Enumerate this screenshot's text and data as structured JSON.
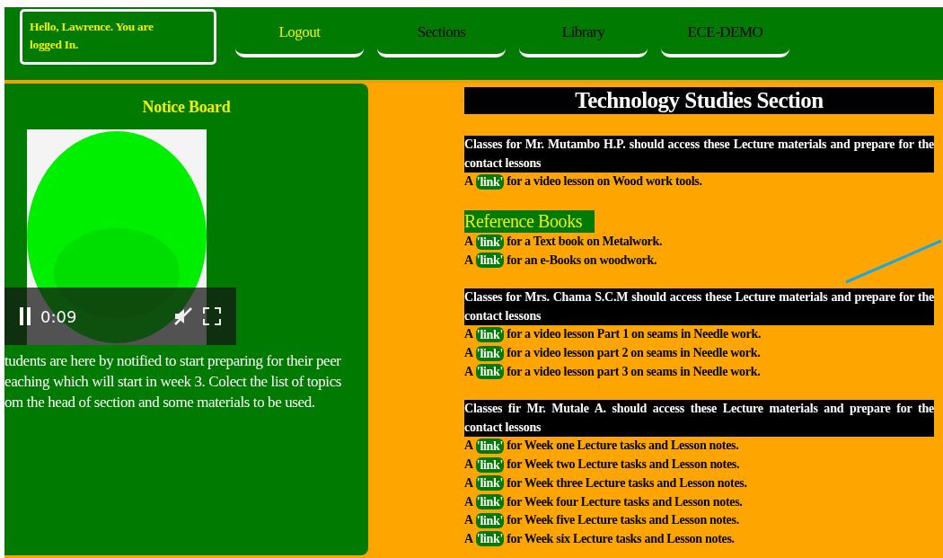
{
  "header": {
    "greeting": "Hello, Lawrence. You are logged In.",
    "nav": [
      {
        "label": "Logout",
        "selected": true
      },
      {
        "label": "Sections",
        "selected": false
      },
      {
        "label": "Library",
        "selected": false
      },
      {
        "label": "ECE-DEMO",
        "selected": false
      }
    ]
  },
  "notice_board": {
    "title": "Notice Board",
    "video": {
      "kind": "picture",
      "time": "0:09",
      "playing": true
    },
    "lines": [
      "tudents are here by notified to start preparing for their peer",
      "eaching which will start in week 3. Colect the list of topics",
      "om the head of section and some materials to be used."
    ]
  },
  "section": {
    "title": "Technology Studies Section",
    "blocks": [
      {
        "kind": "banner",
        "title": "Classes for Mr. Mutambo H.P. should access these Lecture materials and prepare for the contact lessons",
        "links": [
          {
            "prefix": "A",
            "link": "'link'",
            "text": "for a video lesson on Wood work tools."
          }
        ]
      },
      {
        "kind": "heading",
        "title": "Reference Books",
        "links": [
          {
            "prefix": "A",
            "link": "'link'",
            "text": "for a Text book on Metalwork."
          },
          {
            "prefix": "A",
            "link": "'link'",
            "text": "for an e-Books on woodwork."
          }
        ]
      },
      {
        "kind": "banner",
        "title": "Classes for Mrs. Chama S.C.M should access these Lecture materials and prepare for the contact lessons",
        "links": [
          {
            "prefix": "A",
            "link": "'link'",
            "text": "for a video lesson Part 1 on seams in Needle work."
          },
          {
            "prefix": "A",
            "link": "'link'",
            "text": "for a video lesson part 2 on seams in Needle work."
          },
          {
            "prefix": "A",
            "link": "'link'",
            "text": "for a video lesson part 3 on seams in Needle work."
          }
        ]
      },
      {
        "kind": "banner",
        "title": "Classes fir Mr. Mutale A. should access these Lecture materials and prepare for the contact lessons",
        "links": [
          {
            "prefix": "A",
            "link": "'link'",
            "text": "for Week one Lecture tasks and Lesson notes."
          },
          {
            "prefix": "A",
            "link": "'link'",
            "text": "for Week two Lecture tasks and Lesson notes."
          },
          {
            "prefix": "A",
            "link": "'link'",
            "text": "for Week three Lecture tasks and Lesson notes."
          },
          {
            "prefix": "A",
            "link": "'link'",
            "text": "for Week four Lecture tasks and Lesson notes."
          },
          {
            "prefix": "A",
            "link": "'link'",
            "text": "for Week five Lecture tasks and Lesson notes."
          },
          {
            "prefix": "A",
            "link": "'link'",
            "text": "for Week six Lecture tasks and Lesson notes."
          }
        ]
      }
    ]
  }
}
